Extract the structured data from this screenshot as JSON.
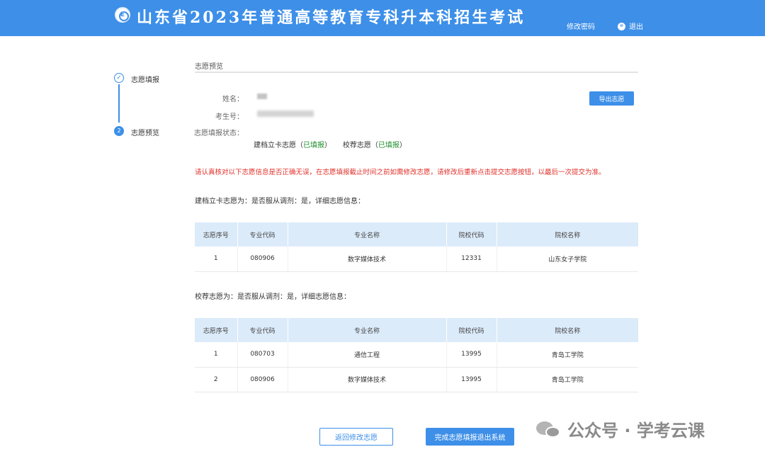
{
  "header": {
    "logo_letter": "E",
    "title": "山东省2023年普通高等教育专科升本科招生考试",
    "change_password": "修改密码",
    "logout": "退出"
  },
  "steps": [
    {
      "label": "志愿填报",
      "marker": "✓"
    },
    {
      "label": "志愿预览",
      "marker": "2"
    }
  ],
  "section_title": "志愿预览",
  "info": {
    "name_label": "姓名：",
    "id_label": "考生号：",
    "status_label": "志愿填报状态：",
    "card_volunteer": "建档立卡志愿（",
    "card_status": "已填报",
    "close_paren": "）",
    "school_volunteer": "校荐志愿（",
    "school_status": "已填报"
  },
  "export_button": "导出志愿",
  "notice": "请认真核对以下志愿信息是否正确无误，在志愿填报截止时间之前如需修改志愿，请修改后重新点击提交志愿按钮，以最后一次提交为准。",
  "table_headers": [
    "志愿序号",
    "专业代码",
    "专业名称",
    "院校代码",
    "院校名称"
  ],
  "card_section": {
    "title": "建档立卡志愿为：是否服从调剂：是，详细志愿信息：",
    "rows": [
      [
        "1",
        "080906",
        "数字媒体技术",
        "12331",
        "山东女子学院"
      ]
    ]
  },
  "school_section": {
    "title": "校荐志愿为：是否服从调剂：是，详细志愿信息：",
    "rows": [
      [
        "1",
        "080703",
        "通信工程",
        "13995",
        "青岛工学院"
      ],
      [
        "2",
        "080906",
        "数字媒体技术",
        "13995",
        "青岛工学院"
      ]
    ]
  },
  "buttons": {
    "back": "返回修改志愿",
    "finish": "完成志愿填报退出系统"
  },
  "watermark": "公众号 · 学考云课",
  "colors": {
    "primary": "#3d8fe8",
    "notice_red": "#e0312b",
    "status_green": "#1f8f2e",
    "table_header_bg": "#dcebfa"
  }
}
